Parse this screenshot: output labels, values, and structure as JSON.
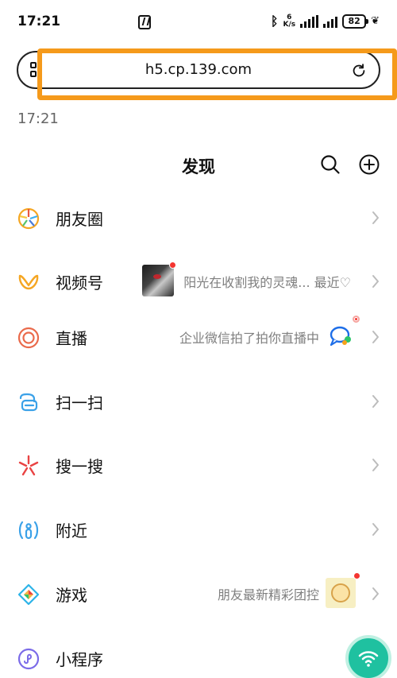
{
  "status_bar": {
    "time": "17:21",
    "speed_value": "6",
    "speed_unit": "K/s",
    "battery": "82"
  },
  "url_bar": {
    "url": "h5.cp.139.com"
  },
  "timestamp": "17:21",
  "header": {
    "title": "发现"
  },
  "rows": [
    {
      "label": "朋友圈",
      "subtitle": ""
    },
    {
      "label": "视频号",
      "subtitle": "阳光在收割我的灵魂... 最近♡"
    },
    {
      "label": "直播",
      "subtitle": "企业微信拍了拍你直播中"
    },
    {
      "label": "扫一扫",
      "subtitle": ""
    },
    {
      "label": "搜一搜",
      "subtitle": ""
    },
    {
      "label": "附近",
      "subtitle": ""
    },
    {
      "label": "游戏",
      "subtitle": "朋友最新精彩团控"
    },
    {
      "label": "小程序",
      "subtitle": ""
    }
  ],
  "colors": {
    "highlight": "#f59a1b",
    "fab": "#1fc1a0",
    "badge": "#f43530"
  }
}
